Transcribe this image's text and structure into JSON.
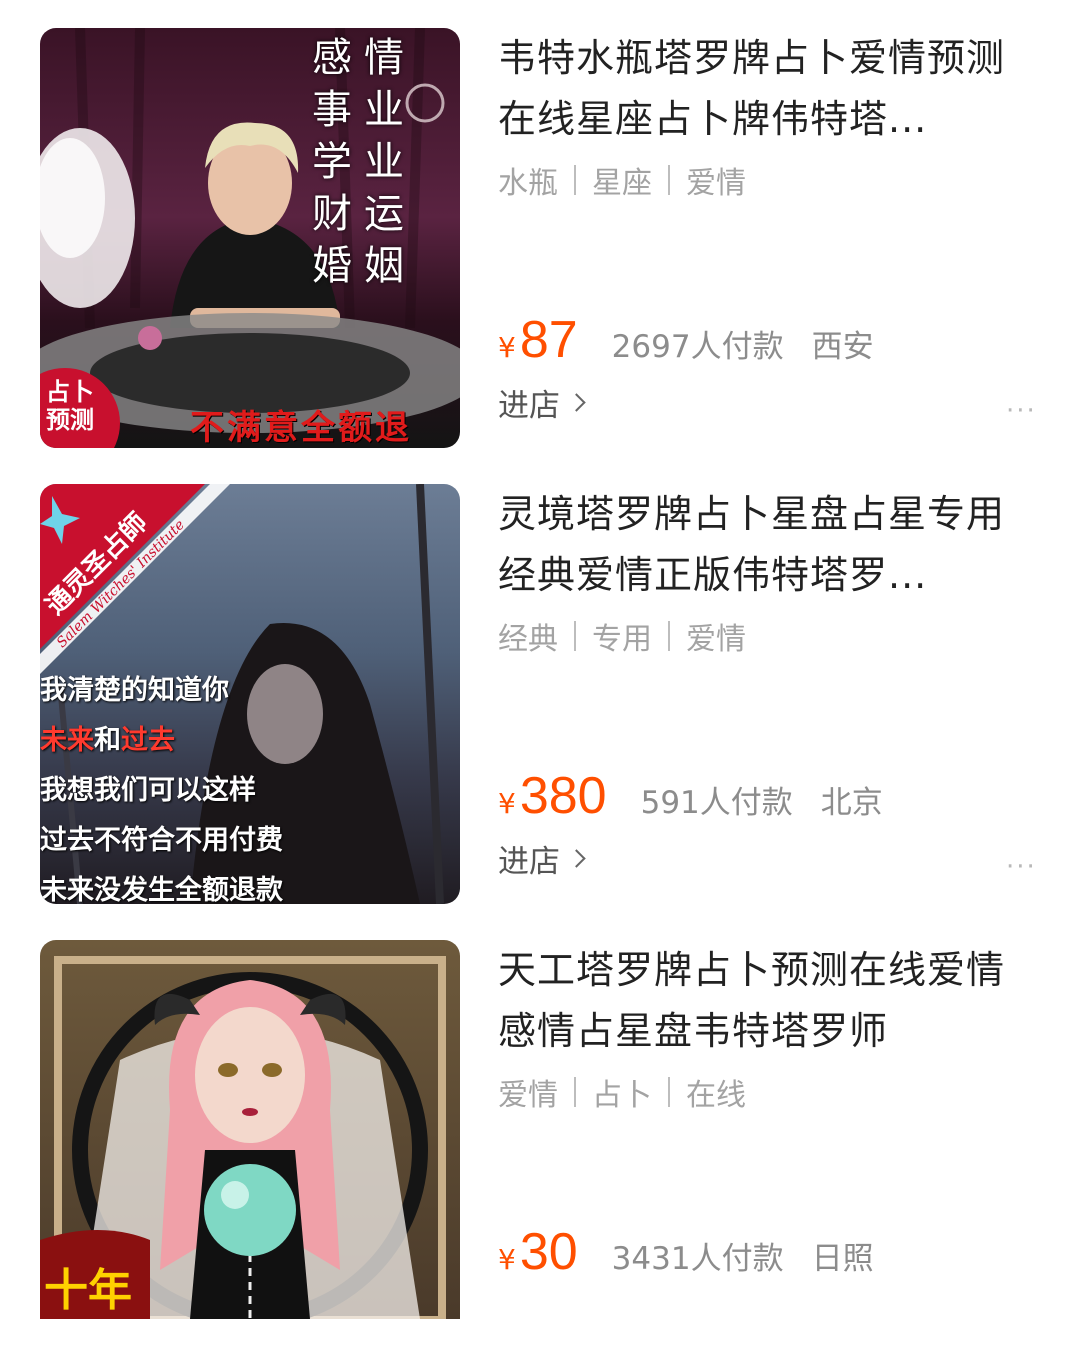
{
  "products": [
    {
      "title": "韦特水瓶塔罗牌占卜爱情预测在线星座占卜牌伟特塔...",
      "tags": [
        "水瓶",
        "星座",
        "爱情"
      ],
      "currency": "¥",
      "price": "87",
      "paid": "2697人付款",
      "city": "西安",
      "shop_label": "进店",
      "more": "···",
      "image": {
        "vertical_words": [
          "感事学财婚",
          "情业业运姻"
        ],
        "badge": "占卜\n预测",
        "banner": "不满意全额退"
      }
    },
    {
      "title": "灵境塔罗牌占卜星盘占星专用 经典爱情正版伟特塔罗...",
      "tags": [
        "经典",
        "专用",
        "爱情"
      ],
      "currency": "¥",
      "price": "380",
      "paid": "591人付款",
      "city": "北京",
      "shop_label": "进店",
      "more": "···",
      "image": {
        "corner_cn": "通灵圣占師",
        "corner_en": "Salem Witches' Institute",
        "line1": "我清楚的知道你",
        "line2a": "未来",
        "line2b": "和",
        "line2c": "过去",
        "line3": "我想我们可以这样",
        "line4": "过去不符合不用付费",
        "line5": "未来没发生全额退款"
      }
    },
    {
      "title": "天工塔罗牌占卜预测在线爱情感情占星盘韦特塔罗师",
      "tags": [
        "爱情",
        "占卜",
        "在线"
      ],
      "currency": "¥",
      "price": "30",
      "paid": "3431人付款",
      "city": "日照",
      "image": {
        "badge": "十年"
      }
    }
  ],
  "colors": {
    "price": "#ff4f00",
    "tag": "#a3a3a3"
  }
}
